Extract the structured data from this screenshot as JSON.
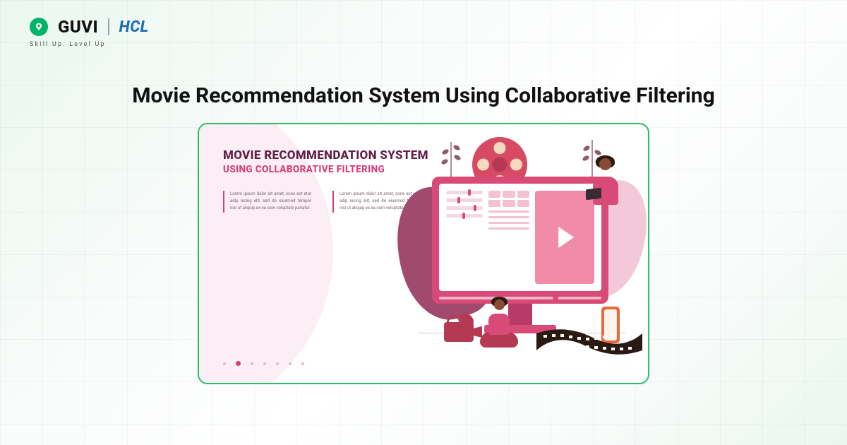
{
  "brand": {
    "guvi_name": "GUVI",
    "hcl_name": "HCL",
    "tagline": "Skill Up. Level Up"
  },
  "page": {
    "title": "Movie Recommendation System Using Collaborative Filtering"
  },
  "card": {
    "heading_line1": "MOVIE RECOMMENDATION SYSTEM",
    "heading_line2": "USING COLLABORATIVE FILTERING",
    "lorem_col1": "Lorem ipsum dolor sit amet, cons ect etur adip iscing elit, sed do eiusmod tempor nisi ut aliquip ex ea com voluptate pariatur.",
    "lorem_col2": "Lorem ipsum dolor sit amet, cons ect etur adip iscing elit, sed do eiusmod tempor nisi ut aliquip ex ea com voluptate pariatur.",
    "dots_total": 7,
    "dots_active_index": 1
  },
  "colors": {
    "accent_green": "#27c06a",
    "brand_pink": "#d84a77",
    "brand_magenta": "#d63d7a"
  }
}
